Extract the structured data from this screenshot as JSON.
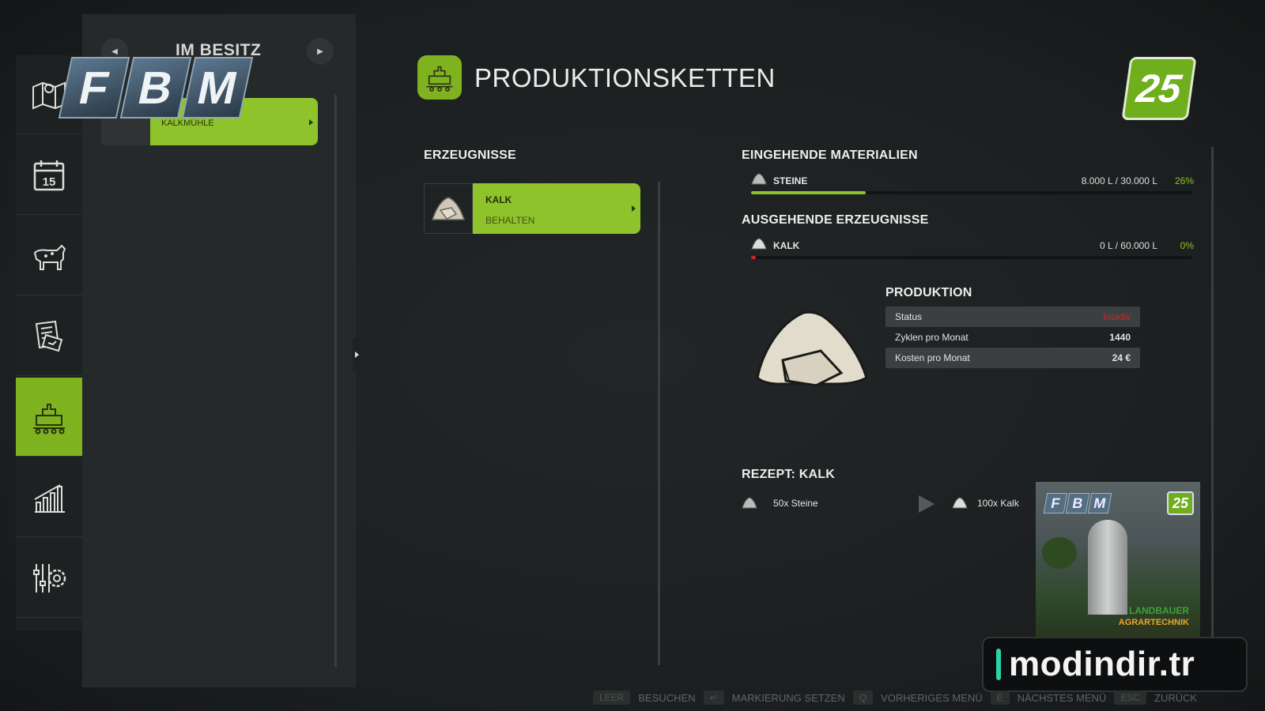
{
  "colors": {
    "accent": "#8fc32b",
    "inactive": "#d52626",
    "panel": "#26292a"
  },
  "nav": [
    {
      "name": "map",
      "icon": "map-icon"
    },
    {
      "name": "calendar",
      "icon": "calendar-icon",
      "day": "15"
    },
    {
      "name": "animals",
      "icon": "cow-icon"
    },
    {
      "name": "contracts",
      "icon": "documents-icon"
    },
    {
      "name": "production",
      "icon": "factory-icon",
      "active": true
    },
    {
      "name": "statistics",
      "icon": "chart-icon"
    },
    {
      "name": "settings",
      "icon": "settings-icon"
    }
  ],
  "owned": {
    "title": "IM BESITZ",
    "item": "KALKMÜHLE"
  },
  "logo": {
    "letters": [
      "F",
      "B",
      "M"
    ]
  },
  "header": {
    "title": "PRODUKTIONSKETTEN",
    "version": "25"
  },
  "products": {
    "title": "ERZEUGNISSE",
    "item": {
      "name": "KALK",
      "mode": "BEHALTEN"
    }
  },
  "incoming": {
    "title": "EINGEHENDE MATERIALIEN",
    "items": [
      {
        "name": "STEINE",
        "amount": "8.000 L / 30.000 L",
        "percent": "26%",
        "fill": 0.26
      }
    ]
  },
  "outgoing": {
    "title": "AUSGEHENDE ERZEUGNISSE",
    "items": [
      {
        "name": "KALK",
        "amount": "0 L / 60.000 L",
        "percent": "0%",
        "fill": 0
      }
    ]
  },
  "production": {
    "title": "PRODUKTION",
    "rows": [
      {
        "label": "Status",
        "value": "Inaktiv"
      },
      {
        "label": "Zyklen pro Monat",
        "value": "1440"
      },
      {
        "label": "Kosten pro Monat",
        "value": "24 €"
      }
    ]
  },
  "recipe": {
    "title": "REZEPT: KALK",
    "input": "50x Steine",
    "output": "100x Kalk"
  },
  "card": {
    "brand1": "LANDBAUER",
    "brand2": "AGRARTECHNIK",
    "version": "25",
    "letters": [
      "F",
      "B",
      "M"
    ]
  },
  "watermark": "modindir.tr",
  "footer": [
    {
      "key": "LEER",
      "label": "BESUCHEN"
    },
    {
      "key": "↵",
      "label": "MARKIERUNG SETZEN"
    },
    {
      "key": "Q",
      "label": "VORHERIGES MENÜ"
    },
    {
      "key": "E",
      "label": "NÄCHSTES MENÜ"
    },
    {
      "key": "ESC",
      "label": "ZURÜCK"
    }
  ]
}
